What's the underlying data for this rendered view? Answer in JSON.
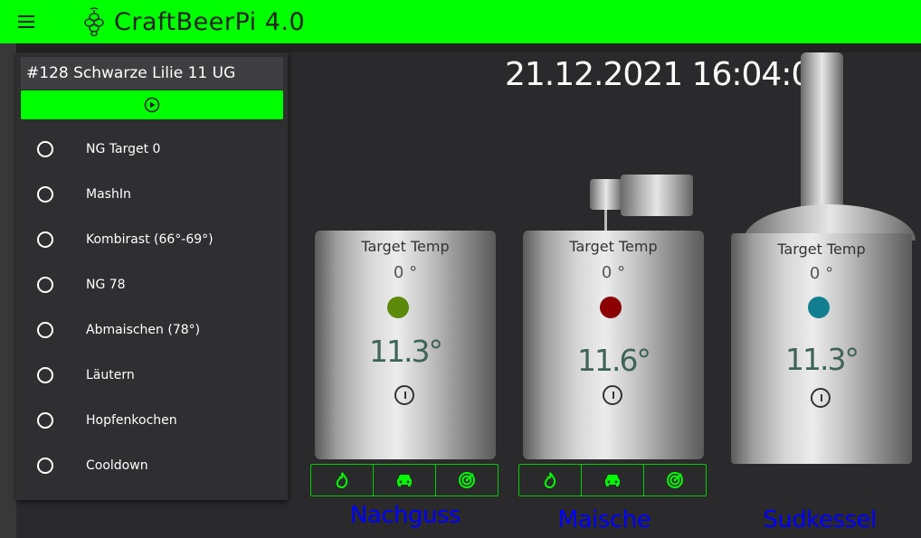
{
  "header": {
    "title": "CraftBeerPi 4.0",
    "menu_icon": "hamburger-icon",
    "logo_icon": "hop-icon"
  },
  "recipe": {
    "name": "#128 Schwarze Lilie 11 UG",
    "start_icon": "play-circle-icon",
    "steps": [
      {
        "label": "NG Target 0"
      },
      {
        "label": "MashIn"
      },
      {
        "label": "Kombirast (66°-69°)"
      },
      {
        "label": "NG 78"
      },
      {
        "label": "Abmaischen (78°)"
      },
      {
        "label": "Läutern"
      },
      {
        "label": "Hopfenkochen"
      },
      {
        "label": "Cooldown"
      }
    ]
  },
  "clock": "21.12.2021 16:04:03",
  "kettles": [
    {
      "name": "Nachguss",
      "target_label": "Target Temp",
      "target_value": "0 °",
      "temp": "11.3°",
      "led_color": "#5d8a0a",
      "actions": [
        "flame-icon",
        "car-icon",
        "radar-icon"
      ]
    },
    {
      "name": "Maische",
      "target_label": "Target Temp",
      "target_value": "0 °",
      "temp": "11.6°",
      "led_color": "#8b0000",
      "actions": [
        "flame-icon",
        "car-icon",
        "radar-icon"
      ]
    },
    {
      "name": "Sudkessel",
      "target_label": "Target Temp",
      "target_value": "0 °",
      "temp": "11.3°",
      "led_color": "#117f90"
    }
  ],
  "colors": {
    "accent": "#00ff00",
    "background": "#2a292b",
    "kettle_name": "#0000ff"
  }
}
